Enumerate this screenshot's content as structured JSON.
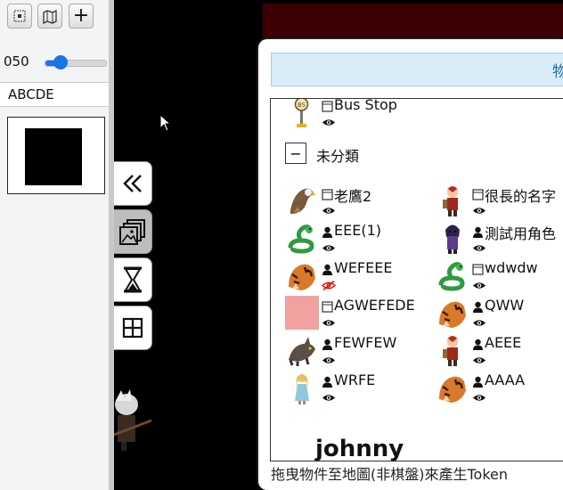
{
  "toolbar": {
    "buttons": [
      {
        "icon": "grid-select-icon"
      },
      {
        "icon": "map-icon"
      },
      {
        "icon": "plus-icon",
        "glyph": "+"
      }
    ]
  },
  "zoom": {
    "value": "050",
    "level_fraction": 0.25
  },
  "name_field": {
    "value": "ABCDE"
  },
  "preview": {
    "color": "#000000"
  },
  "side_tabs": [
    {
      "icon": "double-chevron-left-icon"
    },
    {
      "icon": "gallery-icon"
    },
    {
      "icon": "hourglass-icon"
    },
    {
      "icon": "grid-icon"
    }
  ],
  "dialog": {
    "title": "物",
    "pinned_token": {
      "name": "Bus Stop",
      "type_icon": "note-icon"
    },
    "group": {
      "toggle": "−",
      "label": "未分類"
    },
    "tokens_left": [
      {
        "name": "老鷹2",
        "type_icon": "note-icon",
        "icon": "eagle-icon",
        "visible": true
      },
      {
        "name": "EEE(1)",
        "type_icon": "person-icon",
        "icon": "snake-icon",
        "visible": true
      },
      {
        "name": "WEFEEE",
        "type_icon": "person-icon",
        "icon": "tiger-icon",
        "visible": false
      },
      {
        "name": "AGWEFEDE",
        "type_icon": "note-icon",
        "icon": "pink-square-icon",
        "visible": true
      },
      {
        "name": "FEWFEW",
        "type_icon": "person-icon",
        "icon": "wolf-icon",
        "visible": true
      },
      {
        "name": "WRFE",
        "type_icon": "person-icon",
        "icon": "girl-icon",
        "visible": true
      }
    ],
    "tokens_right": [
      {
        "name": "很長的名字",
        "type_icon": "note-icon",
        "icon": "warrior-icon",
        "visible": true
      },
      {
        "name": "測試用角色",
        "type_icon": "person-icon",
        "icon": "mage-icon",
        "visible": true
      },
      {
        "name": "wdwdw",
        "type_icon": "note-icon",
        "icon": "snake-icon",
        "visible": true
      },
      {
        "name": "QWW",
        "type_icon": "person-icon",
        "icon": "tiger-icon",
        "visible": true
      },
      {
        "name": "AEEE",
        "type_icon": "person-icon",
        "icon": "warrior-icon",
        "visible": true
      },
      {
        "name": "AAAA",
        "type_icon": "person-icon",
        "icon": "tiger-icon",
        "visible": true
      }
    ],
    "partial_name": "johnny",
    "footer_hint": "拖曳物件至地圖(非棋盤)來產生Token"
  },
  "colors": {
    "accent": "#1a73e8",
    "hidden_eye": "#d11",
    "map_strip": "#3d0005"
  }
}
